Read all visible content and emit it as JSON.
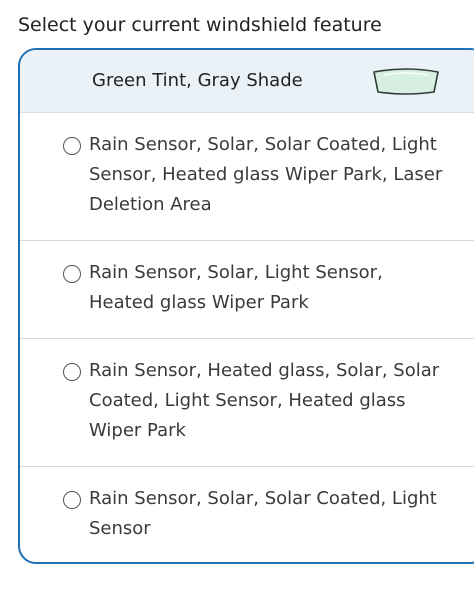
{
  "prompt": "Select your current windshield feature",
  "selected": {
    "label": "Green Tint, Gray Shade",
    "icon": "windshield-icon",
    "icon_fill": "#d7efe3"
  },
  "options": [
    {
      "label": "Rain Sensor, Solar, Solar Coated, Light Sensor, Heated glass Wiper Park, Laser Deletion Area"
    },
    {
      "label": "Rain Sensor, Solar, Light Sensor, Heated glass Wiper Park"
    },
    {
      "label": "Rain Sensor, Heated glass, Solar, Solar Coated, Light Sensor, Heated glass Wiper Park"
    },
    {
      "label": "Rain Sensor, Solar, Solar Coated, Light Sensor"
    }
  ],
  "colors": {
    "accent_border": "#1f6fb2",
    "header_bg": "#eaf2f8"
  }
}
